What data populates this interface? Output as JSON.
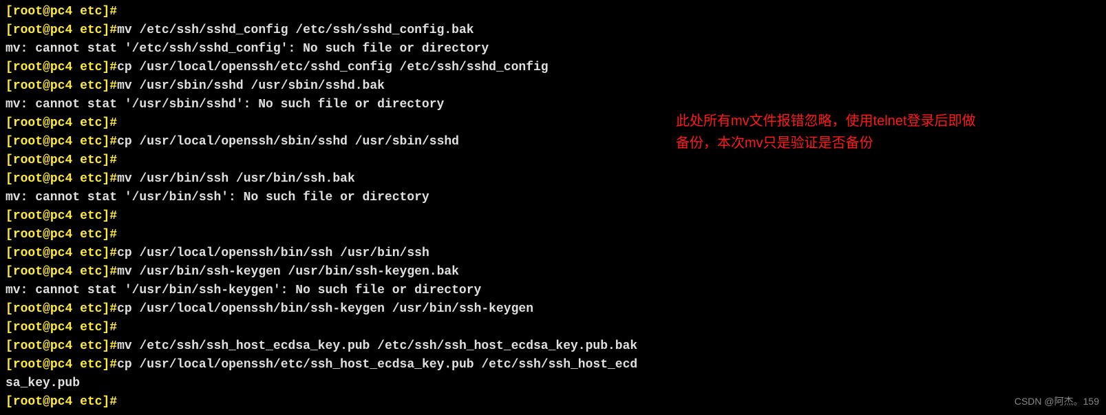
{
  "prompt": {
    "open": "[",
    "user": "root",
    "at": "@",
    "host": "pc4",
    "dir": "etc",
    "close": "]",
    "hash": "#"
  },
  "lines": [
    {
      "type": "prompt",
      "cmd": ""
    },
    {
      "type": "prompt",
      "cmd": "mv /etc/ssh/sshd_config /etc/ssh/sshd_config.bak"
    },
    {
      "type": "out",
      "text": "mv: cannot stat '/etc/ssh/sshd_config': No such file or directory"
    },
    {
      "type": "prompt",
      "cmd": "cp /usr/local/openssh/etc/sshd_config /etc/ssh/sshd_config"
    },
    {
      "type": "prompt",
      "cmd": "mv /usr/sbin/sshd /usr/sbin/sshd.bak"
    },
    {
      "type": "out",
      "text": "mv: cannot stat '/usr/sbin/sshd': No such file or directory"
    },
    {
      "type": "prompt",
      "cmd": ""
    },
    {
      "type": "prompt",
      "cmd": "cp /usr/local/openssh/sbin/sshd /usr/sbin/sshd"
    },
    {
      "type": "prompt",
      "cmd": ""
    },
    {
      "type": "prompt",
      "cmd": "mv /usr/bin/ssh /usr/bin/ssh.bak"
    },
    {
      "type": "out",
      "text": "mv: cannot stat '/usr/bin/ssh': No such file or directory"
    },
    {
      "type": "prompt",
      "cmd": ""
    },
    {
      "type": "prompt",
      "cmd": ""
    },
    {
      "type": "prompt",
      "cmd": "cp /usr/local/openssh/bin/ssh /usr/bin/ssh"
    },
    {
      "type": "prompt",
      "cmd": "mv /usr/bin/ssh-keygen /usr/bin/ssh-keygen.bak"
    },
    {
      "type": "out",
      "text": "mv: cannot stat '/usr/bin/ssh-keygen': No such file or directory"
    },
    {
      "type": "prompt",
      "cmd": "cp /usr/local/openssh/bin/ssh-keygen /usr/bin/ssh-keygen"
    },
    {
      "type": "prompt",
      "cmd": ""
    },
    {
      "type": "prompt",
      "cmd": "mv /etc/ssh/ssh_host_ecdsa_key.pub /etc/ssh/ssh_host_ecdsa_key.pub.bak"
    },
    {
      "type": "prompt",
      "cmd": "cp /usr/local/openssh/etc/ssh_host_ecdsa_key.pub /etc/ssh/ssh_host_ecd"
    },
    {
      "type": "out",
      "text": "sa_key.pub"
    },
    {
      "type": "prompt",
      "cmd": ""
    }
  ],
  "annotation": {
    "line1": "此处所有mv文件报错忽略，使用telnet登录后即做",
    "line2": "备份，本次mv只是验证是否备份"
  },
  "watermark": "CSDN @阿杰。159"
}
